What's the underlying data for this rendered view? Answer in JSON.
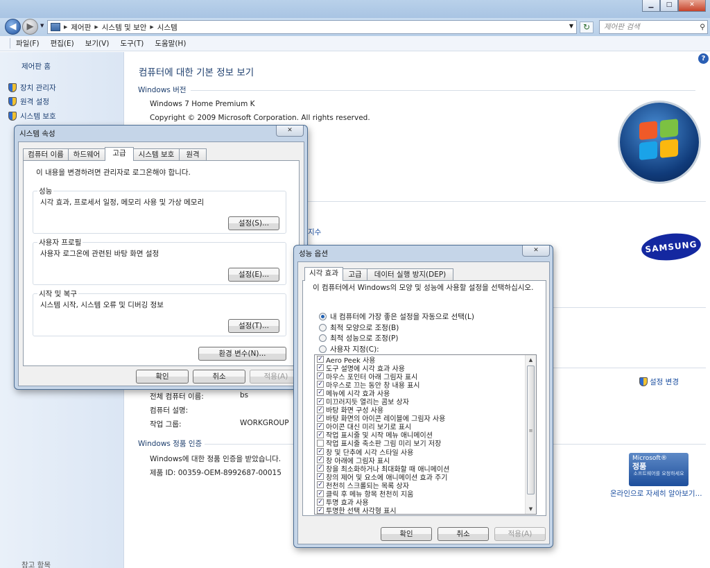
{
  "explorer": {
    "breadcrumb": [
      "제어판",
      "시스템 및 보안",
      "시스템"
    ],
    "search_placeholder": "제어판 검색",
    "menu": [
      "파일(F)",
      "편집(E)",
      "보기(V)",
      "도구(T)",
      "도움말(H)"
    ]
  },
  "sidebar": {
    "home": "제어판 홈",
    "tasks": [
      "장치 관리자",
      "원격 설정",
      "시스템 보호"
    ],
    "see_also": "참고 항목"
  },
  "main": {
    "title": "컴퓨터에 대한 기본 정보 보기",
    "edition": {
      "heading": "Windows 버전",
      "name": "Windows 7 Home Premium K",
      "copyright": "Copyright © 2009 Microsoft Corporation. All rights reserved."
    },
    "partial_link": "지수",
    "samsung": "SAMSUNG",
    "computer": {
      "name_label": "전체 컴퓨터 이름:",
      "name_value": "bs",
      "desc_label": "컴퓨터 설명:",
      "workgroup_label": "작업 그룹:",
      "workgroup_value": "WORKGROUP",
      "change_settings": "설정 변경"
    },
    "activation": {
      "heading": "Windows 정품 인증",
      "status": "Windows에 대한 정품 인증을 받았습니다.",
      "product_id": "제품 ID: 00359-OEM-8992687-00015",
      "learn_more": "온라인으로 자세히 알아보기..."
    },
    "genuine": {
      "brand": "Microsoft®",
      "label": "정품",
      "sub": "소프트웨어를 요청하세요"
    }
  },
  "sysprops": {
    "title": "시스템 속성",
    "tabs": [
      "컴퓨터 이름",
      "하드웨어",
      "고급",
      "시스템 보호",
      "원격"
    ],
    "note": "이 내용을 변경하려면 관리자로 로그온해야 합니다.",
    "groups": [
      {
        "title": "성능",
        "desc": "시각 효과, 프로세서 일정, 메모리 사용 및 가상 메모리",
        "button": "설정(S)..."
      },
      {
        "title": "사용자 프로필",
        "desc": "사용자 로그온에 관련된 바탕 화면 설정",
        "button": "설정(E)..."
      },
      {
        "title": "시작 및 복구",
        "desc": "시스템 시작, 시스템 오류 및 디버깅 정보",
        "button": "설정(T)..."
      }
    ],
    "env_button": "환경 변수(N)...",
    "ok": "확인",
    "cancel": "취소",
    "apply": "적용(A)"
  },
  "perfopts": {
    "title": "성능 옵션",
    "tabs": [
      "시각 효과",
      "고급",
      "데이터 실행 방지(DEP)"
    ],
    "intro": "이 컴퓨터에서 Windows의 모양 및 성능에 사용할 설정을 선택하십시오.",
    "radios": [
      {
        "label": "내 컴퓨터에 가장 좋은 설정을 자동으로 선택(L)",
        "selected": true
      },
      {
        "label": "최적 모양으로 조정(B)",
        "selected": false
      },
      {
        "label": "최적 성능으로 조정(P)",
        "selected": false
      },
      {
        "label": "사용자 지정(C):",
        "selected": false
      }
    ],
    "effects": [
      {
        "label": "Aero Peek 사용",
        "checked": true
      },
      {
        "label": "도구 설명에 시각 효과 사용",
        "checked": true
      },
      {
        "label": "마우스 포인터 아래 그림자 표시",
        "checked": true
      },
      {
        "label": "마우스로 끄는 동안 창 내용 표시",
        "checked": true
      },
      {
        "label": "메뉴에 시각 효과 사용",
        "checked": true
      },
      {
        "label": "미끄러지듯 열리는 콤보 상자",
        "checked": true
      },
      {
        "label": "바탕 화면 구성 사용",
        "checked": true
      },
      {
        "label": "바탕 화면의 아이콘 레이블에 그림자 사용",
        "checked": true
      },
      {
        "label": "아이콘 대신 미리 보기로 표시",
        "checked": true
      },
      {
        "label": "작업 표시줄 및 시작 메뉴 애니메이션",
        "checked": true
      },
      {
        "label": "작업 표시줄 축소판 그림 미리 보기 저장",
        "checked": false
      },
      {
        "label": "창 및 단추에 시각 스타일 사용",
        "checked": true
      },
      {
        "label": "창 아래에 그림자 표시",
        "checked": true
      },
      {
        "label": "창을 최소화하거나 최대화할 때 애니메이션",
        "checked": true
      },
      {
        "label": "창의 제어 및 요소에 애니메이션 효과 주기",
        "checked": true
      },
      {
        "label": "천천히 스크롤되는 목록 상자",
        "checked": true
      },
      {
        "label": "클릭 후 메뉴 항목 천천히 지움",
        "checked": true
      },
      {
        "label": "투명 효과 사용",
        "checked": true
      },
      {
        "label": "투명한 선택 사각형 표시",
        "checked": true
      }
    ],
    "ok": "확인",
    "cancel": "취소",
    "apply": "적용(A)"
  },
  "icons": {
    "back": "back-arrow-icon",
    "forward": "forward-arrow-icon",
    "refresh": "refresh-icon",
    "search": "search-icon",
    "help": "help-icon",
    "shield": "shield-icon",
    "close": "close-icon"
  },
  "colors": {
    "link": "#1c4fa0",
    "heading": "#1e3f6e",
    "dialog_frame": "#c5d5e8"
  }
}
